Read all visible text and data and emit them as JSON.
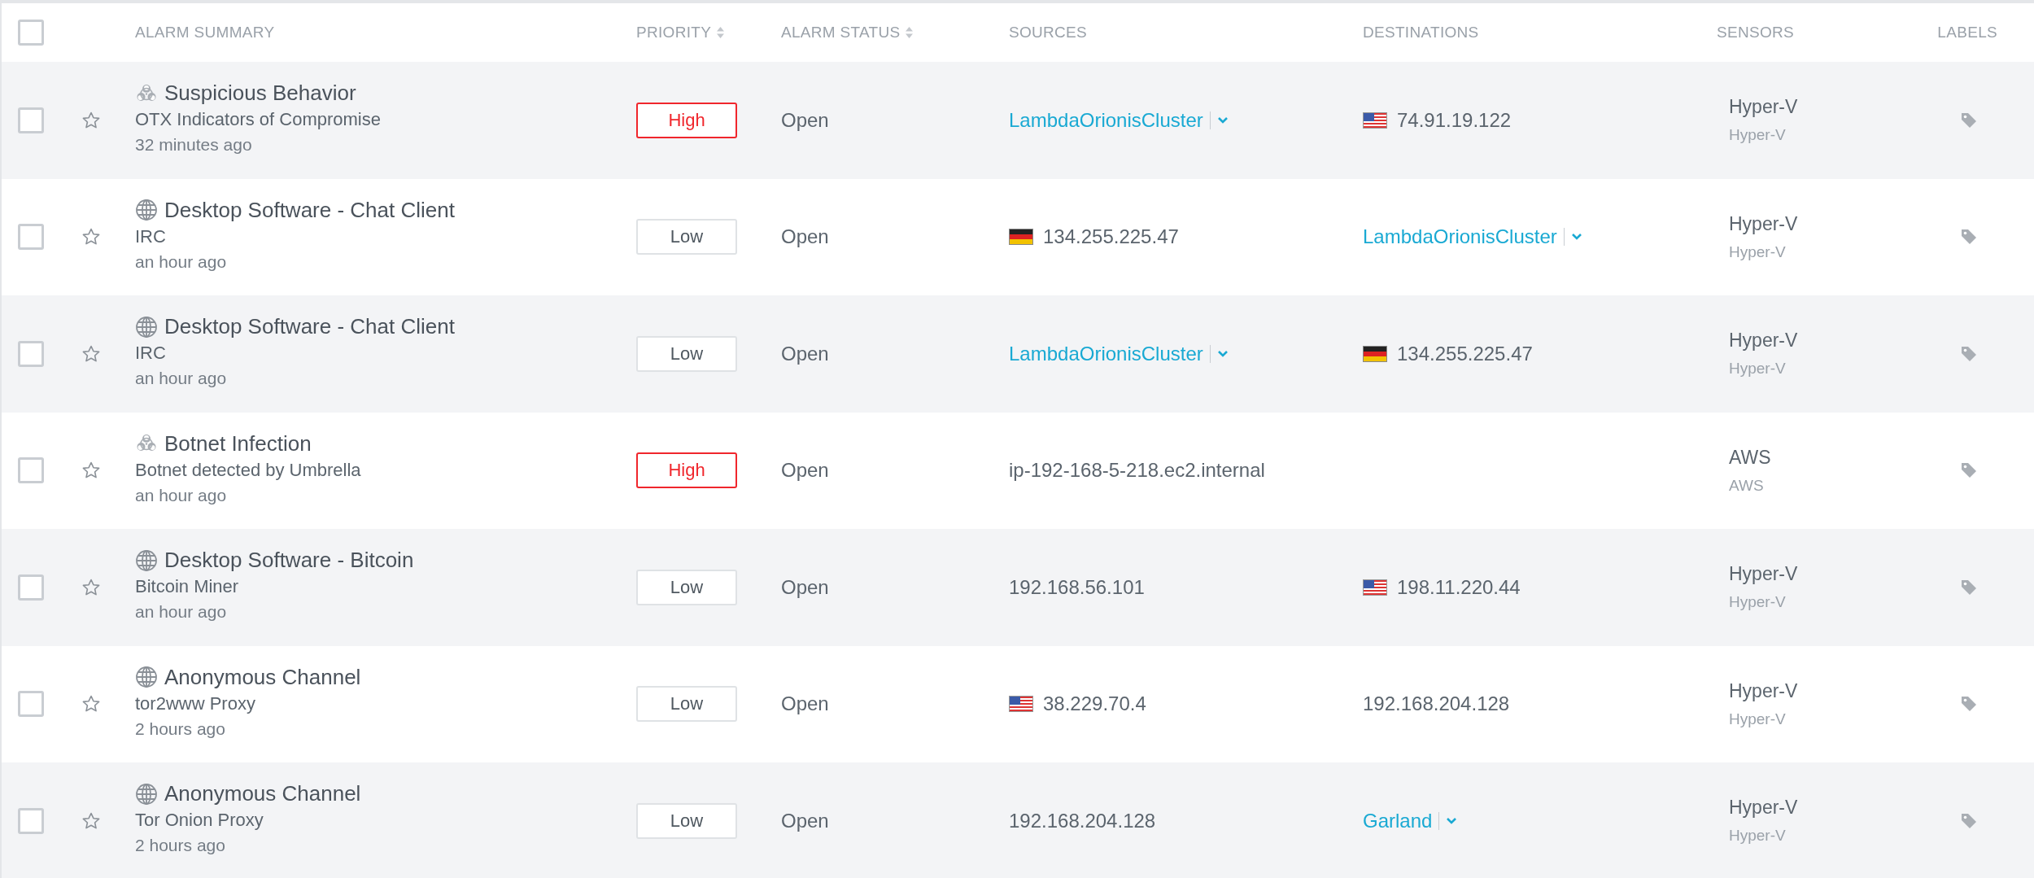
{
  "table": {
    "header_checked": false,
    "columns": [
      {
        "label": "ALARM SUMMARY",
        "sortable": false
      },
      {
        "label": "PRIORITY",
        "sortable": true
      },
      {
        "label": "ALARM STATUS",
        "sortable": true
      },
      {
        "label": "SOURCES",
        "sortable": false
      },
      {
        "label": "DESTINATIONS",
        "sortable": false
      },
      {
        "label": "SENSORS",
        "sortable": false
      },
      {
        "label": "LABELS",
        "sortable": false
      }
    ],
    "rows": [
      {
        "kind": "biohazard",
        "checked": false,
        "starred": false,
        "title": "Suspicious Behavior",
        "subtitle": "OTX Indicators of Compromise",
        "time": "32 minutes ago",
        "priority": {
          "text": "High",
          "kind": "high"
        },
        "status": "Open",
        "source": {
          "kind": "asset",
          "text": "LambdaOrionisCluster"
        },
        "destination": {
          "kind": "us",
          "text": "74.91.19.122"
        },
        "sensor": "Hyper-V",
        "sensor_sub": "Hyper-V"
      },
      {
        "kind": "globe",
        "checked": false,
        "starred": false,
        "title": "Desktop Software - Chat Client",
        "subtitle": "IRC",
        "time": "an hour ago",
        "priority": {
          "text": "Low",
          "kind": "low"
        },
        "status": "Open",
        "source": {
          "kind": "de",
          "text": "134.255.225.47"
        },
        "destination": {
          "kind": "asset",
          "text": "LambdaOrionisCluster"
        },
        "sensor": "Hyper-V",
        "sensor_sub": "Hyper-V"
      },
      {
        "kind": "globe",
        "checked": false,
        "starred": false,
        "title": "Desktop Software - Chat Client",
        "subtitle": "IRC",
        "time": "an hour ago",
        "priority": {
          "text": "Low",
          "kind": "low"
        },
        "status": "Open",
        "source": {
          "kind": "asset",
          "text": "LambdaOrionisCluster"
        },
        "destination": {
          "kind": "de",
          "text": "134.255.225.47"
        },
        "sensor": "Hyper-V",
        "sensor_sub": "Hyper-V"
      },
      {
        "kind": "biohazard",
        "checked": false,
        "starred": false,
        "title": "Botnet Infection",
        "subtitle": "Botnet detected by Umbrella",
        "time": "an hour ago",
        "priority": {
          "text": "High",
          "kind": "high"
        },
        "status": "Open",
        "source": {
          "kind": "ip",
          "text": "ip-192-168-5-218.ec2.internal"
        },
        "sensor": "AWS",
        "sensor_sub": "AWS"
      },
      {
        "kind": "globe",
        "checked": false,
        "starred": false,
        "title": "Desktop Software - Bitcoin",
        "subtitle": "Bitcoin Miner",
        "time": "an hour ago",
        "priority": {
          "text": "Low",
          "kind": "low"
        },
        "status": "Open",
        "source": {
          "kind": "ip",
          "text": "192.168.56.101"
        },
        "destination": {
          "kind": "us",
          "text": "198.11.220.44"
        },
        "sensor": "Hyper-V",
        "sensor_sub": "Hyper-V"
      },
      {
        "kind": "globe",
        "checked": false,
        "starred": false,
        "title": "Anonymous Channel",
        "subtitle": "tor2www Proxy",
        "time": "2 hours ago",
        "priority": {
          "text": "Low",
          "kind": "low"
        },
        "status": "Open",
        "source": {
          "kind": "us",
          "text": "38.229.70.4"
        },
        "destination": {
          "kind": "ip",
          "text": "192.168.204.128"
        },
        "sensor": "Hyper-V",
        "sensor_sub": "Hyper-V"
      },
      {
        "kind": "globe",
        "checked": false,
        "starred": false,
        "title": "Anonymous Channel",
        "subtitle": "Tor Onion Proxy",
        "time": "2 hours ago",
        "priority": {
          "text": "Low",
          "kind": "low"
        },
        "status": "Open",
        "source": {
          "kind": "ip",
          "text": "192.168.204.128"
        },
        "destination": {
          "kind": "asset",
          "text": "Garland"
        },
        "sensor": "Hyper-V",
        "sensor_sub": "Hyper-V"
      }
    ]
  }
}
